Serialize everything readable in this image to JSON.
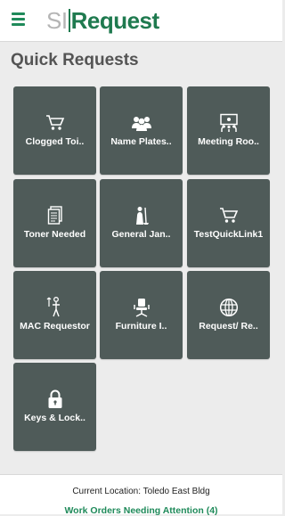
{
  "header": {
    "logo_left": "SI",
    "logo_right": "Request",
    "menu_icon": "hamburger-menu-icon"
  },
  "page": {
    "title": "Quick Requests"
  },
  "tiles": [
    {
      "label": "Clogged Toi..",
      "icon": "shopping-cart-icon"
    },
    {
      "label": "Name Plates..",
      "icon": "people-group-icon"
    },
    {
      "label": "Meeting Roo..",
      "icon": "presentation-board-icon"
    },
    {
      "label": "Toner Needed",
      "icon": "document-icon"
    },
    {
      "label": "General Jan..",
      "icon": "janitor-mop-icon"
    },
    {
      "label": "TestQuickLink1",
      "icon": "shopping-cart-icon"
    },
    {
      "label": "MAC Requestor",
      "icon": "person-move-icon"
    },
    {
      "label": "Furniture I..",
      "icon": "office-chair-icon"
    },
    {
      "label": "Request/ Re..",
      "icon": "globe-icon"
    },
    {
      "label": "Keys & Lock..",
      "icon": "padlock-icon"
    }
  ],
  "footer": {
    "location": "Current Location: Toledo East Bldg",
    "attention": "Work Orders Needing Attention (4)"
  },
  "colors": {
    "accent": "#1f7a4f",
    "tile": "#4f5b59",
    "background": "#ececec"
  }
}
